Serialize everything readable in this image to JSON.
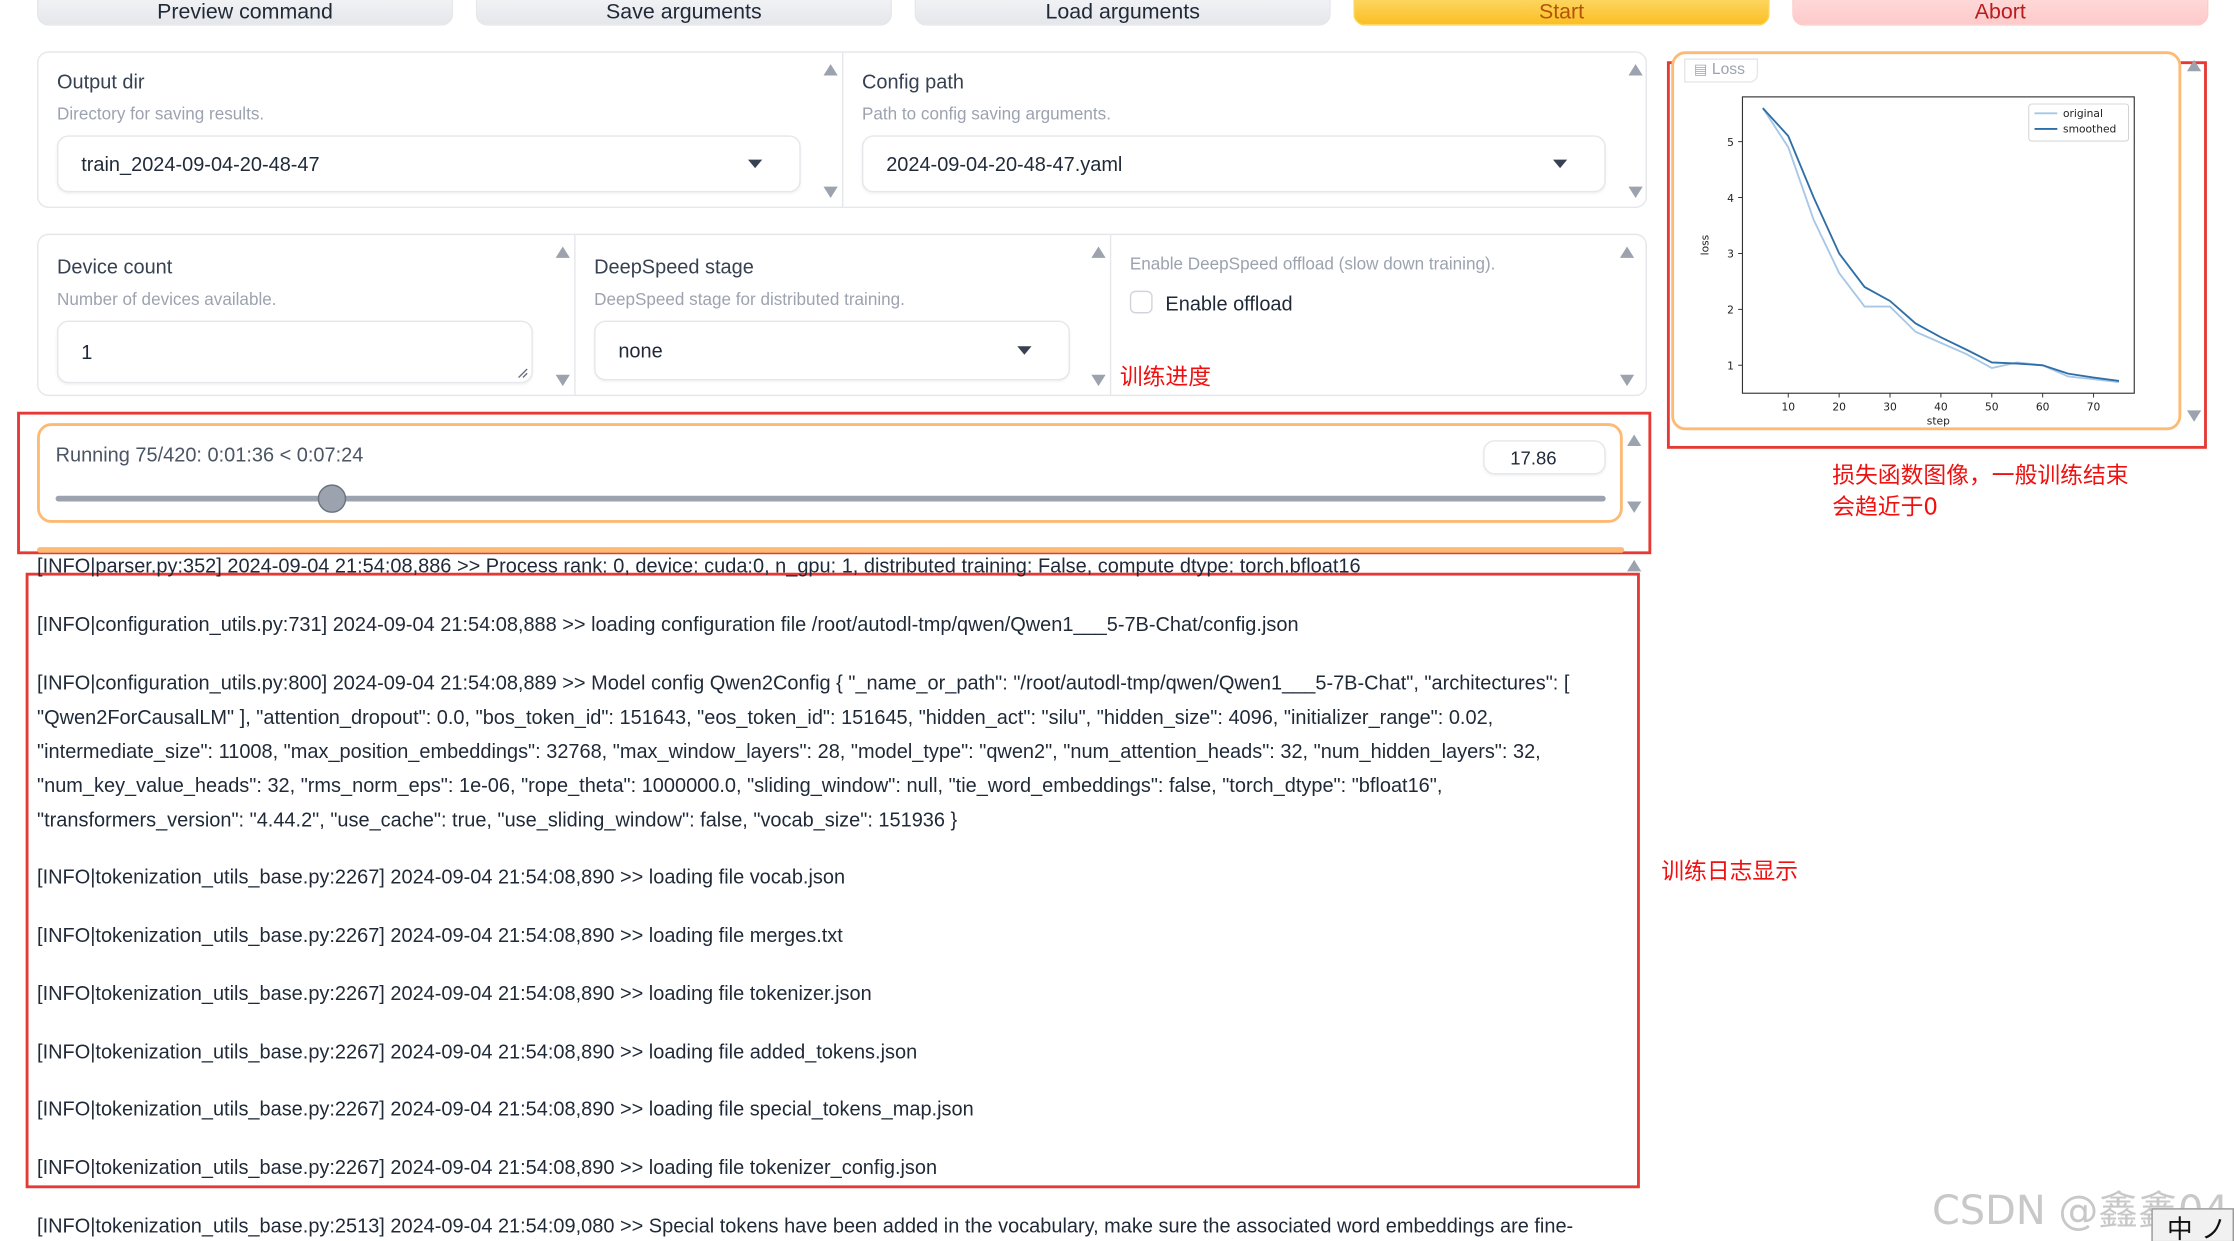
{
  "toolbar": {
    "preview_label": "Preview command",
    "save_label": "Save arguments",
    "load_label": "Load arguments",
    "start_label": "Start",
    "abort_label": "Abort"
  },
  "output_dir": {
    "label": "Output dir",
    "info": "Directory for saving results.",
    "value": "train_2024-09-04-20-48-47"
  },
  "config_path": {
    "label": "Config path",
    "info": "Path to config saving arguments.",
    "value": "2024-09-04-20-48-47.yaml"
  },
  "device_count": {
    "label": "Device count",
    "info": "Number of devices available.",
    "value": "1"
  },
  "deepspeed": {
    "label": "DeepSpeed stage",
    "info": "DeepSpeed stage for distributed training.",
    "value": "none"
  },
  "offload": {
    "info": "Enable DeepSpeed offload (slow down training).",
    "label": "Enable offload",
    "checked": false
  },
  "progress": {
    "label": "Running 75/420: 0:01:36 < 0:07:24",
    "value_text": "17.86",
    "fraction": 0.1786
  },
  "annotations": {
    "progress": "训练进度",
    "loss_line1": "损失函数图像，一般训练结束",
    "loss_line2": "会趋近于0",
    "log": "训练日志显示"
  },
  "chart_data": {
    "type": "line",
    "title": "",
    "tab_label": "Loss",
    "xlabel": "step",
    "ylabel": "loss",
    "xlim": [
      1,
      78
    ],
    "ylim": [
      0.5,
      5.8
    ],
    "xticks": [
      10,
      20,
      30,
      40,
      50,
      60,
      70
    ],
    "yticks": [
      1,
      2,
      3,
      4,
      5
    ],
    "legend_position": "top-right",
    "series": [
      {
        "name": "original",
        "color": "#a7c7e7",
        "x": [
          5,
          10,
          15,
          20,
          25,
          30,
          35,
          40,
          45,
          50,
          55,
          60,
          65,
          70,
          75
        ],
        "y": [
          5.6,
          4.9,
          3.6,
          2.65,
          2.05,
          2.05,
          1.6,
          1.4,
          1.2,
          0.95,
          1.05,
          1.0,
          0.8,
          0.75,
          0.7
        ]
      },
      {
        "name": "smoothed",
        "color": "#2f6fa7",
        "x": [
          5,
          10,
          15,
          20,
          25,
          30,
          35,
          40,
          45,
          50,
          55,
          60,
          65,
          70,
          75
        ],
        "y": [
          5.6,
          5.1,
          4.0,
          3.0,
          2.4,
          2.15,
          1.75,
          1.5,
          1.28,
          1.05,
          1.03,
          1.0,
          0.85,
          0.78,
          0.72
        ]
      }
    ]
  },
  "log_lines": [
    "[INFO|parser.py:352] 2024-09-04 21:54:08,886 >> Process rank: 0, device: cuda:0, n_gpu: 1, distributed training: False, compute dtype: torch.bfloat16",
    "[INFO|configuration_utils.py:731] 2024-09-04 21:54:08,888 >> loading configuration file /root/autodl-tmp/qwen/Qwen1___5-7B-Chat/config.json",
    "[INFO|configuration_utils.py:800] 2024-09-04 21:54:08,889 >> Model config Qwen2Config { \"_name_or_path\": \"/root/autodl-tmp/qwen/Qwen1___5-7B-Chat\", \"architectures\": [ \"Qwen2ForCausalLM\" ], \"attention_dropout\": 0.0, \"bos_token_id\": 151643, \"eos_token_id\": 151645, \"hidden_act\": \"silu\", \"hidden_size\": 4096, \"initializer_range\": 0.02, \"intermediate_size\": 11008, \"max_position_embeddings\": 32768, \"max_window_layers\": 28, \"model_type\": \"qwen2\", \"num_attention_heads\": 32, \"num_hidden_layers\": 32, \"num_key_value_heads\": 32, \"rms_norm_eps\": 1e-06, \"rope_theta\": 1000000.0, \"sliding_window\": null, \"tie_word_embeddings\": false, \"torch_dtype\": \"bfloat16\", \"transformers_version\": \"4.44.2\", \"use_cache\": true, \"use_sliding_window\": false, \"vocab_size\": 151936 }",
    "[INFO|tokenization_utils_base.py:2267] 2024-09-04 21:54:08,890 >> loading file vocab.json",
    "[INFO|tokenization_utils_base.py:2267] 2024-09-04 21:54:08,890 >> loading file merges.txt",
    "[INFO|tokenization_utils_base.py:2267] 2024-09-04 21:54:08,890 >> loading file tokenizer.json",
    "[INFO|tokenization_utils_base.py:2267] 2024-09-04 21:54:08,890 >> loading file added_tokens.json",
    "[INFO|tokenization_utils_base.py:2267] 2024-09-04 21:54:08,890 >> loading file special_tokens_map.json",
    "[INFO|tokenization_utils_base.py:2267] 2024-09-04 21:54:08,890 >> loading file tokenizer_config.json",
    "[INFO|tokenization_utils_base.py:2513] 2024-09-04 21:54:09,080 >> Special tokens have been added in the vocabulary, make sure the associated word embeddings are fine-tuned or"
  ],
  "watermark": "CSDN @鑫鑫04",
  "ime_text": "中 ノ"
}
